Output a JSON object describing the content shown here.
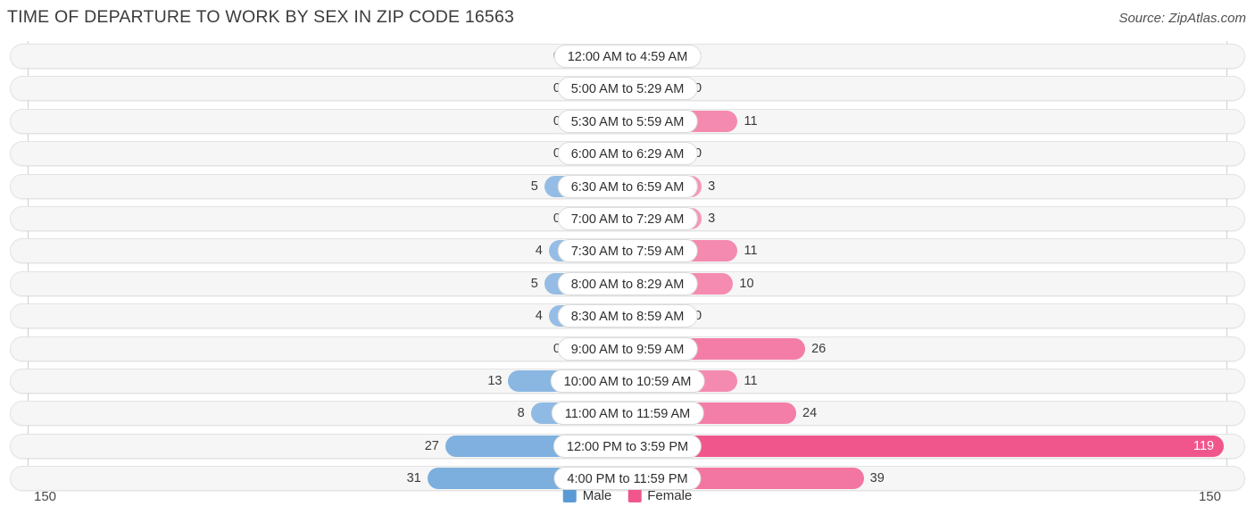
{
  "header": {
    "title": "TIME OF DEPARTURE TO WORK BY SEX IN ZIP CODE 16563",
    "source": "Source: ZipAtlas.com"
  },
  "legend": {
    "items": [
      {
        "label": "Male",
        "color": "#5b9bd5"
      },
      {
        "label": "Female",
        "color": "#f0568c"
      }
    ]
  },
  "axis": {
    "left_max": "150",
    "right_max": "150"
  },
  "colors": {
    "male_light": "#a8c8ea",
    "male_dark": "#5b9bd5",
    "female_light": "#f7a8c4",
    "female_dark": "#f0568c",
    "track": "#f6f6f6",
    "track_border": "#e3e3e3"
  },
  "chart_data": {
    "type": "bar",
    "orientation": "horizontal-diverging",
    "title": "TIME OF DEPARTURE TO WORK BY SEX IN ZIP CODE 16563",
    "xlabel": "",
    "ylabel": "",
    "xlim": [
      0,
      150
    ],
    "grid": false,
    "legend_position": "bottom-center",
    "categories": [
      "12:00 AM to 4:59 AM",
      "5:00 AM to 5:29 AM",
      "5:30 AM to 5:59 AM",
      "6:00 AM to 6:29 AM",
      "6:30 AM to 6:59 AM",
      "7:00 AM to 7:29 AM",
      "7:30 AM to 7:59 AM",
      "8:00 AM to 8:29 AM",
      "8:30 AM to 8:59 AM",
      "9:00 AM to 9:59 AM",
      "10:00 AM to 10:59 AM",
      "11:00 AM to 11:59 AM",
      "12:00 PM to 3:59 PM",
      "4:00 PM to 11:59 PM"
    ],
    "series": [
      {
        "name": "Male",
        "color": "#5b9bd5",
        "values": [
          0,
          0,
          0,
          0,
          5,
          0,
          4,
          5,
          4,
          0,
          13,
          8,
          27,
          31
        ]
      },
      {
        "name": "Female",
        "color": "#f0568c",
        "values": [
          0,
          0,
          11,
          0,
          3,
          3,
          11,
          10,
          0,
          26,
          11,
          24,
          119,
          39
        ]
      }
    ]
  },
  "rows": [
    {
      "label": "12:00 AM to 4:59 AM",
      "male": "0",
      "female": "0"
    },
    {
      "label": "5:00 AM to 5:29 AM",
      "male": "0",
      "female": "0"
    },
    {
      "label": "5:30 AM to 5:59 AM",
      "male": "0",
      "female": "11"
    },
    {
      "label": "6:00 AM to 6:29 AM",
      "male": "0",
      "female": "0"
    },
    {
      "label": "6:30 AM to 6:59 AM",
      "male": "5",
      "female": "3"
    },
    {
      "label": "7:00 AM to 7:29 AM",
      "male": "0",
      "female": "3"
    },
    {
      "label": "7:30 AM to 7:59 AM",
      "male": "4",
      "female": "11"
    },
    {
      "label": "8:00 AM to 8:29 AM",
      "male": "5",
      "female": "10"
    },
    {
      "label": "8:30 AM to 8:59 AM",
      "male": "4",
      "female": "0"
    },
    {
      "label": "9:00 AM to 9:59 AM",
      "male": "0",
      "female": "26"
    },
    {
      "label": "10:00 AM to 10:59 AM",
      "male": "13",
      "female": "11"
    },
    {
      "label": "11:00 AM to 11:59 AM",
      "male": "8",
      "female": "24"
    },
    {
      "label": "12:00 PM to 3:59 PM",
      "male": "27",
      "female": "119"
    },
    {
      "label": "4:00 PM to 11:59 PM",
      "male": "31",
      "female": "39"
    }
  ]
}
